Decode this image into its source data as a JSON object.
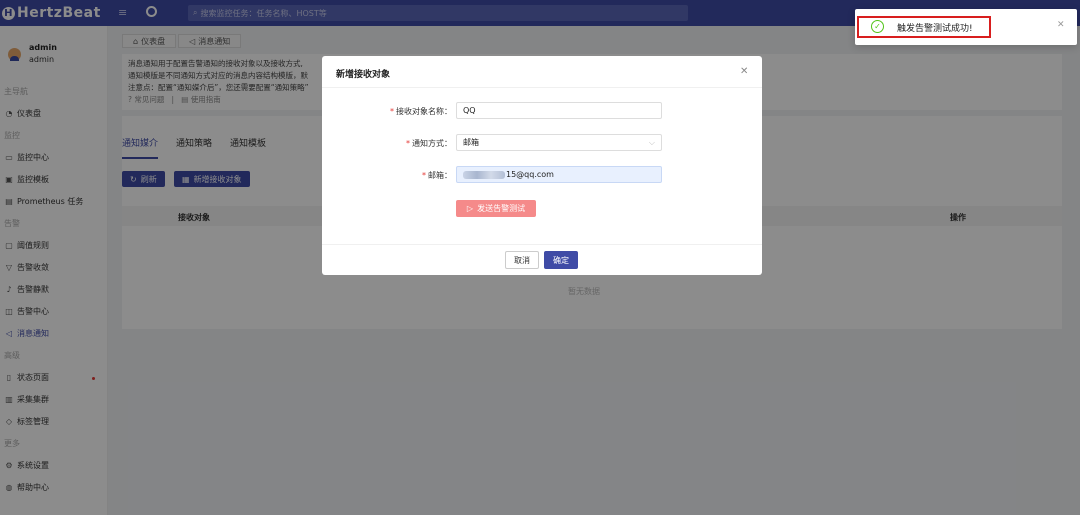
{
  "app": {
    "name": "HertzBeat"
  },
  "topbar": {
    "search_placeholder": "搜索监控任务：任务名称、HOST等"
  },
  "user": {
    "name": "admin",
    "role": "admin"
  },
  "sidebar": {
    "sections": [
      "主导航",
      "监控",
      "告警",
      "高级",
      "更多"
    ],
    "items": [
      {
        "label": "仪表盘",
        "icon": "dashboard-icon"
      },
      {
        "label": "监控中心",
        "icon": "monitor-icon"
      },
      {
        "label": "监控模板",
        "icon": "template-icon"
      },
      {
        "label": "Prometheus 任务",
        "icon": "table-icon"
      },
      {
        "label": "阈值规则",
        "icon": "rule-icon"
      },
      {
        "label": "告警收敛",
        "icon": "filter-icon"
      },
      {
        "label": "告警静默",
        "icon": "mute-icon"
      },
      {
        "label": "告警中心",
        "icon": "alarm-icon"
      },
      {
        "label": "消息通知",
        "icon": "notice-icon"
      },
      {
        "label": "状态页面",
        "icon": "status-page-icon"
      },
      {
        "label": "采集集群",
        "icon": "cluster-icon"
      },
      {
        "label": "标签管理",
        "icon": "tag-icon"
      },
      {
        "label": "系统设置",
        "icon": "settings-icon"
      },
      {
        "label": "帮助中心",
        "icon": "help-icon"
      }
    ]
  },
  "page_tabs": [
    "仪表盘",
    "消息通知"
  ],
  "info": {
    "line1": "消息通知用于配置告警通知的接收对象以及接收方式,",
    "line2": "通知模版是不同通知方式对应的消息内容结构模版，默",
    "line3": "注意点：配置“通知媒介后”，您还需要配置“通知策略”",
    "link1": "常见问题",
    "sep": "|",
    "link2": "使用指南"
  },
  "main_tabs": [
    "通知媒介",
    "通知策略",
    "通知模板"
  ],
  "buttons": {
    "refresh": "刷新",
    "add_receiver": "新增接收对象"
  },
  "table": {
    "headers": [
      "接收对象",
      "操作"
    ],
    "empty": "暂无数据"
  },
  "modal": {
    "title": "新增接收对象",
    "fields": [
      {
        "label": "接收对象名称",
        "value": "QQ"
      },
      {
        "label": "通知方式",
        "value": "邮箱"
      },
      {
        "label": "邮箱",
        "value": "15@qq.com"
      }
    ],
    "test_button": "发送告警测试",
    "cancel": "取消",
    "ok": "确定"
  },
  "toast": {
    "message": "触发告警测试成功!",
    "status_color": "#52c41a"
  },
  "colors": {
    "brand": "#3f4ba6",
    "danger": "#e53935",
    "test_button": "#f58a8a"
  }
}
